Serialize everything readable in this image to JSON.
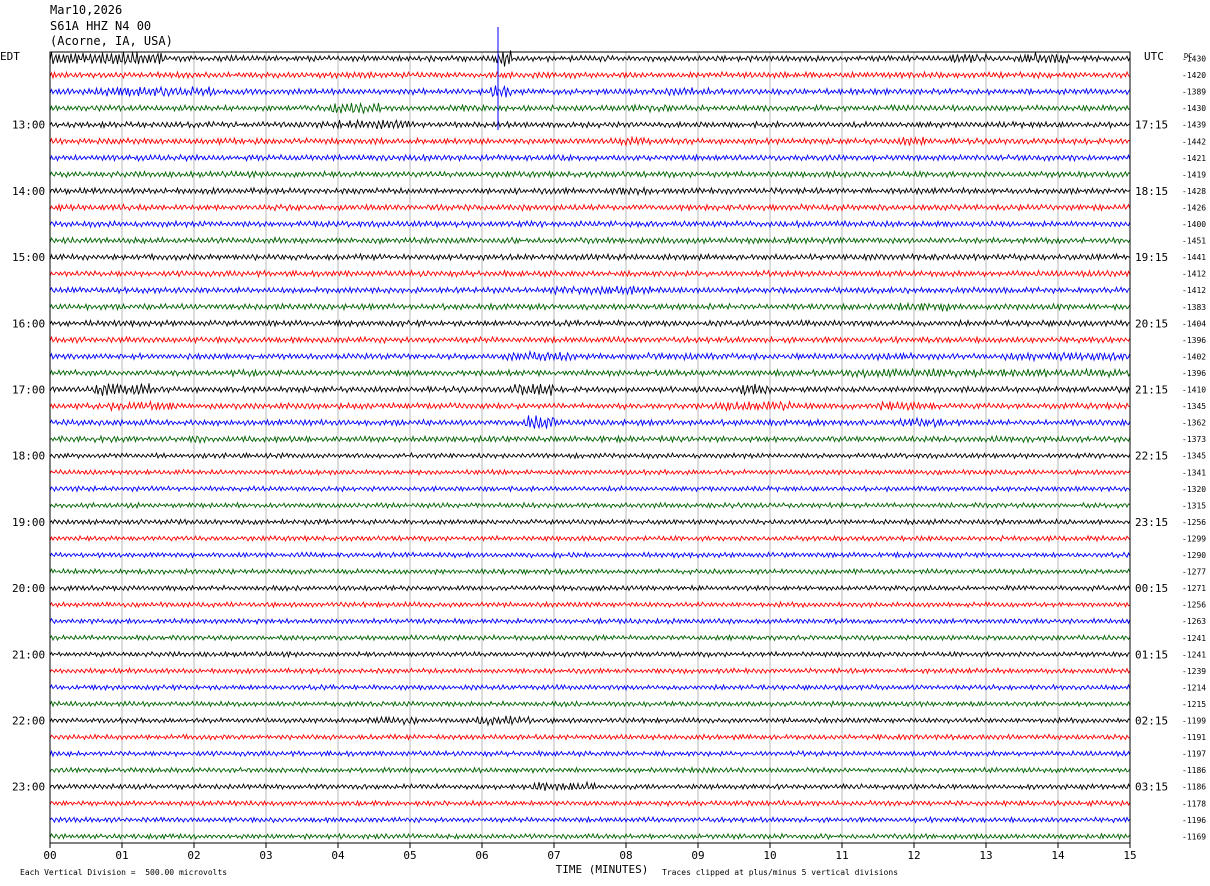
{
  "header": {
    "date": "Mar10,2026",
    "station": "S61A HHZ N4 00",
    "location": "(Acorne, IA, USA)"
  },
  "chart_data": {
    "type": "line",
    "title": "Mar10,2026 S61A HHZ N4 00 (Acorne, IA, USA)",
    "xlabel": "TIME (MINUTES)",
    "x_ticks": [
      "00",
      "01",
      "02",
      "03",
      "04",
      "05",
      "06",
      "07",
      "08",
      "09",
      "10",
      "11",
      "12",
      "13",
      "14",
      "15"
    ],
    "xlim": [
      0,
      15
    ],
    "left_axis_label": "EDT",
    "right_axis_label": "UTC",
    "dc_label": "DC",
    "left_hour_labels": [
      "13:00",
      "14:00",
      "15:00",
      "16:00",
      "17:00",
      "18:00",
      "19:00",
      "20:00",
      "21:00",
      "22:00",
      "23:00"
    ],
    "right_hour_labels": [
      "17:15",
      "18:15",
      "19:15",
      "20:15",
      "21:15",
      "22:15",
      "23:15",
      "00:15",
      "01:15",
      "02:15",
      "03:15"
    ],
    "trace_colors": [
      "#000000",
      "#ff0000",
      "#0000ff",
      "#006400"
    ],
    "dc_offsets": [
      -1430,
      -1420,
      -1389,
      -1430,
      -1439,
      -1442,
      -1421,
      -1419,
      -1428,
      -1426,
      -1400,
      -1451,
      -1441,
      -1412,
      -1412,
      -1383,
      -1404,
      -1396,
      -1402,
      -1396,
      -1410,
      -1345,
      -1362,
      -1373,
      -1345,
      -1341,
      -1320,
      -1315,
      -1256,
      -1299,
      -1290,
      -1277,
      -1271,
      -1256,
      -1263,
      -1241,
      -1241,
      -1239,
      -1214,
      -1215,
      -1199,
      -1191,
      -1197,
      -1186,
      -1186,
      -1178,
      -1196,
      -1169
    ],
    "trace_interval_minutes": 15,
    "traces_per_hour": 4,
    "grid_vertical": true
  },
  "footer": {
    "scale_note": "Each Vertical Division =  500.00 microvolts",
    "clip_note": "Traces clipped at plus/minus 5 vertical divisions"
  }
}
